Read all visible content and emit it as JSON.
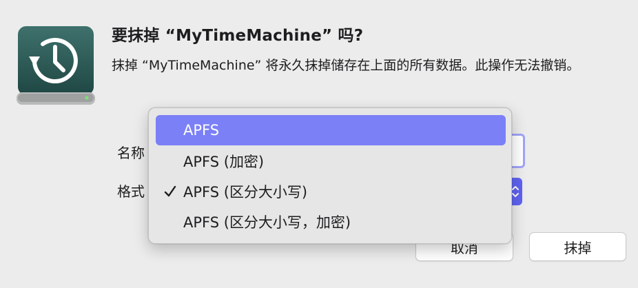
{
  "dialog": {
    "title": "要抹掉 “MyTimeMachine” 吗?",
    "message": "抹掉 “MyTimeMachine” 将永久抹掉储存在上面的所有数据。此操作无法撤销。",
    "icon": "time-machine-drive-icon"
  },
  "form": {
    "name_label": "名称",
    "format_label": "格式"
  },
  "format_menu": {
    "items": [
      {
        "label": "APFS",
        "highlighted": true,
        "checked": false
      },
      {
        "label": "APFS (加密)",
        "highlighted": false,
        "checked": false
      },
      {
        "label": "APFS (区分大小写)",
        "highlighted": false,
        "checked": true
      },
      {
        "label": "APFS (区分大小写，加密)",
        "highlighted": false,
        "checked": false
      }
    ],
    "highlight_color": "#7b80f7"
  },
  "buttons": {
    "cancel": "取消",
    "erase": "抹掉"
  },
  "colors": {
    "accent": "#5f63ef",
    "focus_ring": "#9fa3f6",
    "drive_body": "#2f5e5a"
  }
}
